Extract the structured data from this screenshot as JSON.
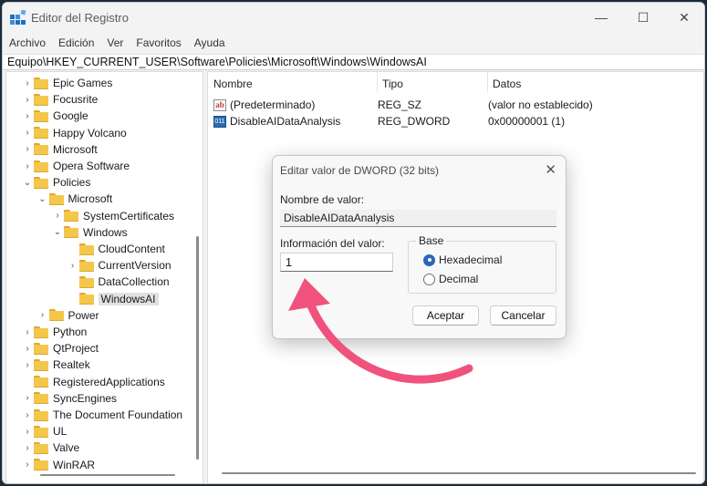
{
  "window": {
    "title": "Editor del Registro",
    "minimize_glyph": "—",
    "maximize_glyph": "☐",
    "close_glyph": "✕"
  },
  "menu": [
    "Archivo",
    "Edición",
    "Ver",
    "Favoritos",
    "Ayuda"
  ],
  "address": "Equipo\\HKEY_CURRENT_USER\\Software\\Policies\\Microsoft\\Windows\\WindowsAI",
  "tree": [
    {
      "label": "Epic Games",
      "chevron": "›",
      "depth": 0
    },
    {
      "label": "Focusrite",
      "chevron": "›",
      "depth": 0
    },
    {
      "label": "Google",
      "chevron": "›",
      "depth": 0
    },
    {
      "label": "Happy Volcano",
      "chevron": "›",
      "depth": 0
    },
    {
      "label": "Microsoft",
      "chevron": "›",
      "depth": 0
    },
    {
      "label": "Opera Software",
      "chevron": "›",
      "depth": 0
    },
    {
      "label": "Policies",
      "chevron": "⌄",
      "depth": 0
    },
    {
      "label": "Microsoft",
      "chevron": "⌄",
      "depth": 1
    },
    {
      "label": "SystemCertificates",
      "chevron": "›",
      "depth": 2
    },
    {
      "label": "Windows",
      "chevron": "⌄",
      "depth": 2
    },
    {
      "label": "CloudContent",
      "chevron": "",
      "depth": 3
    },
    {
      "label": "CurrentVersion",
      "chevron": "›",
      "depth": 3
    },
    {
      "label": "DataCollection",
      "chevron": "",
      "depth": 3
    },
    {
      "label": "WindowsAI",
      "chevron": "",
      "depth": 3,
      "selected": true
    },
    {
      "label": "Power",
      "chevron": "›",
      "depth": 1
    },
    {
      "label": "Python",
      "chevron": "›",
      "depth": 0
    },
    {
      "label": "QtProject",
      "chevron": "›",
      "depth": 0
    },
    {
      "label": "Realtek",
      "chevron": "›",
      "depth": 0
    },
    {
      "label": "RegisteredApplications",
      "chevron": "",
      "depth": 0
    },
    {
      "label": "SyncEngines",
      "chevron": "›",
      "depth": 0
    },
    {
      "label": "The Document Foundation",
      "chevron": "›",
      "depth": 0
    },
    {
      "label": "UL",
      "chevron": "›",
      "depth": 0
    },
    {
      "label": "Valve",
      "chevron": "›",
      "depth": 0
    },
    {
      "label": "WinRAR",
      "chevron": "›",
      "depth": 0
    }
  ],
  "list": {
    "headers": [
      "Nombre",
      "Tipo",
      "Datos"
    ],
    "rows": [
      {
        "icon": "ab",
        "icon_name": "string-value-icon",
        "name": "(Predeterminado)",
        "type": "REG_SZ",
        "data": "(valor no establecido)"
      },
      {
        "icon": "011",
        "icon_name": "dword-value-icon",
        "name": "DisableAIDataAnalysis",
        "type": "REG_DWORD",
        "data": "0x00000001 (1)"
      }
    ]
  },
  "dialog": {
    "title": "Editar valor de DWORD (32 bits)",
    "close_glyph": "✕",
    "name_label": "Nombre de valor:",
    "name_value": "DisableAIDataAnalysis",
    "value_label": "Información del valor:",
    "value_value": "1",
    "base_label": "Base",
    "base_options": [
      "Hexadecimal",
      "Decimal"
    ],
    "base_selected": "Hexadecimal",
    "ok_label": "Aceptar",
    "cancel_label": "Cancelar"
  },
  "colors": {
    "accent": "#2a67b8",
    "annotation_arrow": "#f0527d",
    "folder": "#f4c74a"
  }
}
